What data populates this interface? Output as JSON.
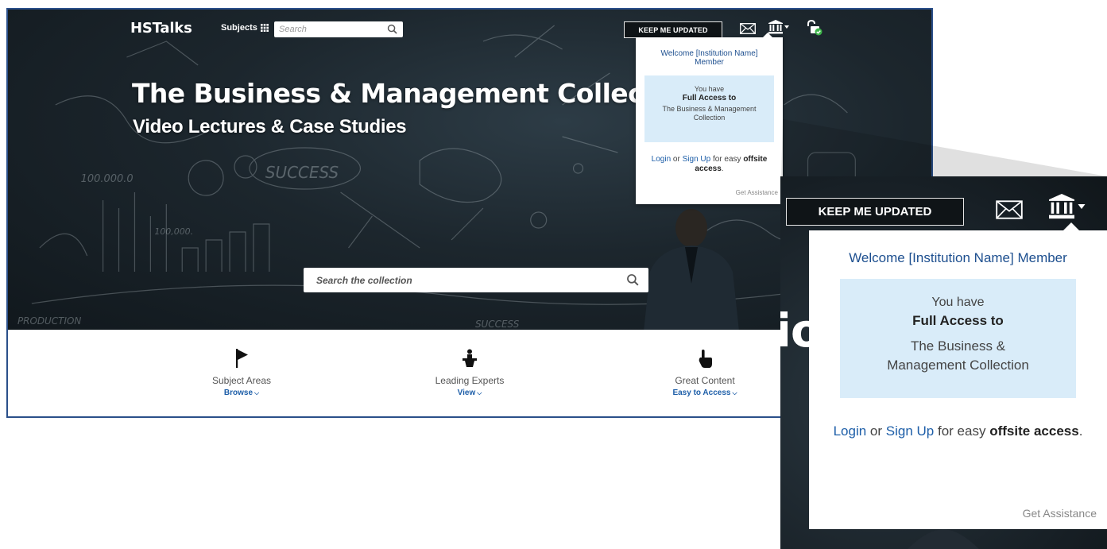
{
  "header": {
    "logo": "HSTalks",
    "subjects_label": "Subjects",
    "search_placeholder": "Search",
    "keep_updated_label": "KEEP ME UPDATED"
  },
  "hero": {
    "title": "The Business & Management Collection",
    "subtitle": "Video Lectures & Case Studies",
    "search_placeholder": "Search the collection"
  },
  "features": [
    {
      "icon": "flag-icon",
      "title": "Subject Areas",
      "link": "Browse"
    },
    {
      "icon": "lectern-speaker-icon",
      "title": "Leading Experts",
      "link": "View"
    },
    {
      "icon": "pointing-hand-icon",
      "title": "Great Content",
      "link": "Easy to Access"
    }
  ],
  "dropdown": {
    "welcome": "Welcome [Institution Name] Member",
    "you_have": "You have",
    "full_access": "Full Access to",
    "collection": "The Business & Management Collection",
    "login": "Login",
    "or": "or",
    "sign_up": "Sign Up",
    "for_easy": "for easy",
    "offsite": "offsite",
    "access": "access",
    "period": ".",
    "get_assistance": "Get Assistance"
  },
  "colors": {
    "frame_border": "#2a4f8a",
    "link_blue": "#1d5ea8",
    "welcome_blue": "#1d4f8f",
    "access_box_bg": "#d9ecf9",
    "hero_dark": "#1c262d",
    "lock_green": "#3db54a"
  }
}
